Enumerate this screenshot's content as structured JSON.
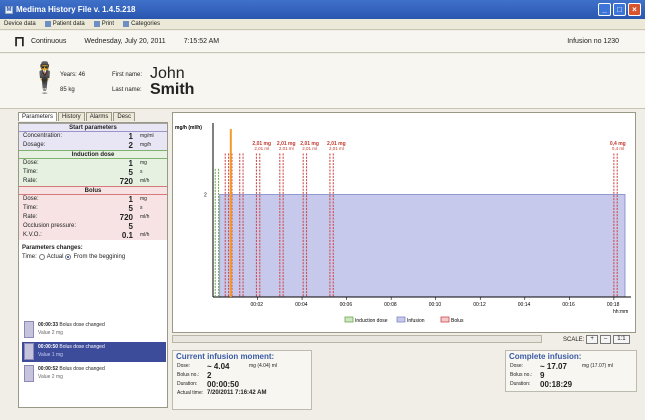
{
  "window": {
    "title": "Medima History File v. 1.4.5.218"
  },
  "menu": [
    "Device data",
    "Patient data",
    "Print",
    "Categories"
  ],
  "status": {
    "mode": "Continuous",
    "date": "Wednesday, July 20, 2011",
    "time": "7:15:52 AM",
    "infusion": "Infusion no 1230"
  },
  "patient": {
    "years_label": "Years: 46",
    "weight_label": "85 kg",
    "first_label": "First name:",
    "first": "John",
    "last_label": "Last name:",
    "last": "Smith"
  },
  "tabs": [
    "Parameters",
    "History",
    "Alarms",
    "Desc"
  ],
  "start_params": {
    "title": "Start parameters",
    "rows": [
      {
        "label": "Concentration:",
        "value": "1",
        "unit": "mg/ml"
      },
      {
        "label": "Dosage:",
        "value": "2",
        "unit": "mg/h"
      }
    ]
  },
  "induction": {
    "title": "Induction dose",
    "rows": [
      {
        "label": "Dose:",
        "value": "1",
        "unit": "mg"
      },
      {
        "label": "Time:",
        "value": "5",
        "unit": "s"
      },
      {
        "label": "Rate:",
        "value": "720",
        "unit": "ml/h"
      }
    ]
  },
  "bolus": {
    "title": "Bolus",
    "rows": [
      {
        "label": "Dose:",
        "value": "1",
        "unit": "mg"
      },
      {
        "label": "Time:",
        "value": "5",
        "unit": "s"
      },
      {
        "label": "Rate:",
        "value": "720",
        "unit": "ml/h"
      },
      {
        "label": "Occlusion pressure:",
        "value": "5",
        "unit": ""
      },
      {
        "label": "K.V.O.:",
        "value": "0.1",
        "unit": "ml/h"
      }
    ]
  },
  "param_changes": {
    "title": "Parameters changes:",
    "time_label": "Time:",
    "opt_actual": "Actual",
    "opt_begin": "From the beggining"
  },
  "changes": [
    {
      "time": "00:00:33",
      "text": "Bolus dose changed",
      "sub": "Value 2 mg"
    },
    {
      "time": "00:00:50",
      "text": "Bolus dose changed",
      "sub": "Value 1 mg"
    },
    {
      "time": "00:00:52",
      "text": "Bolus dose changed",
      "sub": "Value 2 mg"
    }
  ],
  "chart_data": {
    "type": "bar",
    "ylabel": "mg/h (ml/h)",
    "y_tick": "2",
    "x_unit": "hh:mm",
    "x_ticks": [
      "00:02",
      "00:04",
      "00:06",
      "00:08",
      "00:10",
      "00:12",
      "00:14",
      "00:16",
      "00:18"
    ],
    "infusion_rate": 2,
    "annotations": [
      {
        "dose": "2,01 mg",
        "vol": "2,01 ml"
      },
      {
        "dose": "2,01 mg",
        "vol": "2,01 ml"
      },
      {
        "dose": "2,01 mg",
        "vol": "2,01 ml"
      },
      {
        "dose": "2,01 mg",
        "vol": "2,01 ml"
      },
      {
        "dose": "0,4 mg",
        "vol": "0,4 ml"
      }
    ],
    "legend": [
      "Induction dose",
      "Infusion",
      "Bolus"
    ],
    "colors": {
      "induction": "#6aaa4a",
      "infusion": "#7f86c8",
      "bolus": "#d04a4a",
      "marker": "#f39a2a"
    }
  },
  "scale": {
    "label": "SCALE:",
    "plus": "+",
    "minus": "–",
    "reset": "1:1"
  },
  "current": {
    "title": "Current infusion moment:",
    "dose_label": "Dose:",
    "dose": "~ 4.04",
    "dose_unit": "mg (4.04) ml",
    "bolus_label": "Bolus no.:",
    "bolus": "2",
    "duration_label": "Duration:",
    "duration": "00:00:50",
    "actual_label": "Actual time:",
    "actual": "7/20/2011   7:16:42 AM"
  },
  "complete": {
    "title": "Complete infusion:",
    "dose_label": "Dose:",
    "dose": "~ 17.07",
    "dose_unit": "mg (17.07) ml",
    "bolus_label": "Bolus no.:",
    "bolus": "9",
    "duration_label": "Duration:",
    "duration": "00:18:29"
  }
}
